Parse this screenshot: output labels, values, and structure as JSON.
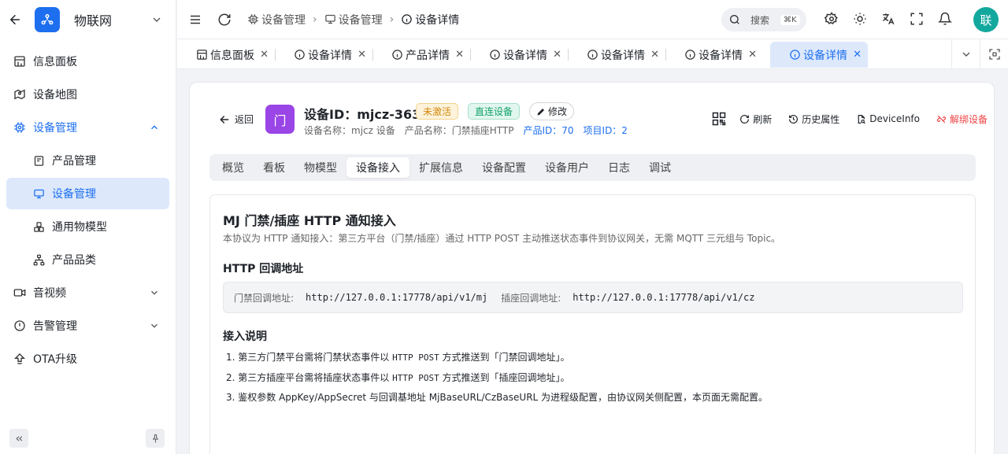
{
  "sidebar": {
    "app_name": "物联网",
    "items": [
      {
        "label": "信息面板"
      },
      {
        "label": "设备地图"
      },
      {
        "label": "设备管理"
      },
      {
        "label": "产品管理"
      },
      {
        "label": "设备管理"
      },
      {
        "label": "通用物模型"
      },
      {
        "label": "产品品类"
      },
      {
        "label": "音视频"
      },
      {
        "label": "告警管理"
      },
      {
        "label": "OTA升级"
      }
    ]
  },
  "header": {
    "breadcrumb": [
      "设备管理",
      "设备管理",
      "设备详情"
    ],
    "search_placeholder": "搜索",
    "search_shortcut": "⌘K",
    "avatar_text": "联"
  },
  "tabs": [
    {
      "label": "信息面板"
    },
    {
      "label": "设备详情"
    },
    {
      "label": "产品详情"
    },
    {
      "label": "设备详情"
    },
    {
      "label": "设备详情"
    },
    {
      "label": "设备详情"
    },
    {
      "label": "设备详情"
    }
  ],
  "device": {
    "back_label": "返回",
    "icon_text": "门",
    "title": "设备ID：mjcz-363",
    "status_badge": "未激活",
    "type_badge": "直连设备",
    "edit_label": "修改",
    "device_name": "设备名称：mjcz 设备",
    "product_name": "产品名称：门禁插座HTTP",
    "product_id": "产品ID：70",
    "project_id": "项目ID：2"
  },
  "actions": {
    "refresh": "刷新",
    "history": "历史属性",
    "device_info": "DeviceInfo",
    "unbind": "解绑设备"
  },
  "subtabs": [
    "概览",
    "看板",
    "物模型",
    "设备接入",
    "扩展信息",
    "设备配置",
    "设备用户",
    "日志",
    "调试"
  ],
  "panel": {
    "title": "MJ 门禁/插座 HTTP 通知接入",
    "description": "本协议为 HTTP 通知接入：第三方平台（门禁/插座）通过 HTTP POST 主动推送状态事件到协议网关，无需 MQTT 三元组与 Topic。",
    "callback_heading": "HTTP 回调地址",
    "door_label": "门禁回调地址:",
    "door_url": "http://127.0.0.1:17778/api/v1/mj",
    "socket_label": "插座回调地址:",
    "socket_url": "http://127.0.0.1:17778/api/v1/cz",
    "instructions_heading": "接入说明",
    "step1_pre": "1. 第三方门禁平台需将门禁状态事件以 ",
    "step1_code": "HTTP POST",
    "step1_post": " 方式推送到「门禁回调地址」。",
    "step2_pre": "2. 第三方插座平台需将插座状态事件以 ",
    "step2_code": "HTTP POST",
    "step2_post": " 方式推送到「插座回调地址」。",
    "step3": "3. 鉴权参数 AppKey/AppSecret 与回调基地址 MjBaseURL/CzBaseURL 为进程级配置，由协议网关侧配置，本页面无需配置。"
  }
}
